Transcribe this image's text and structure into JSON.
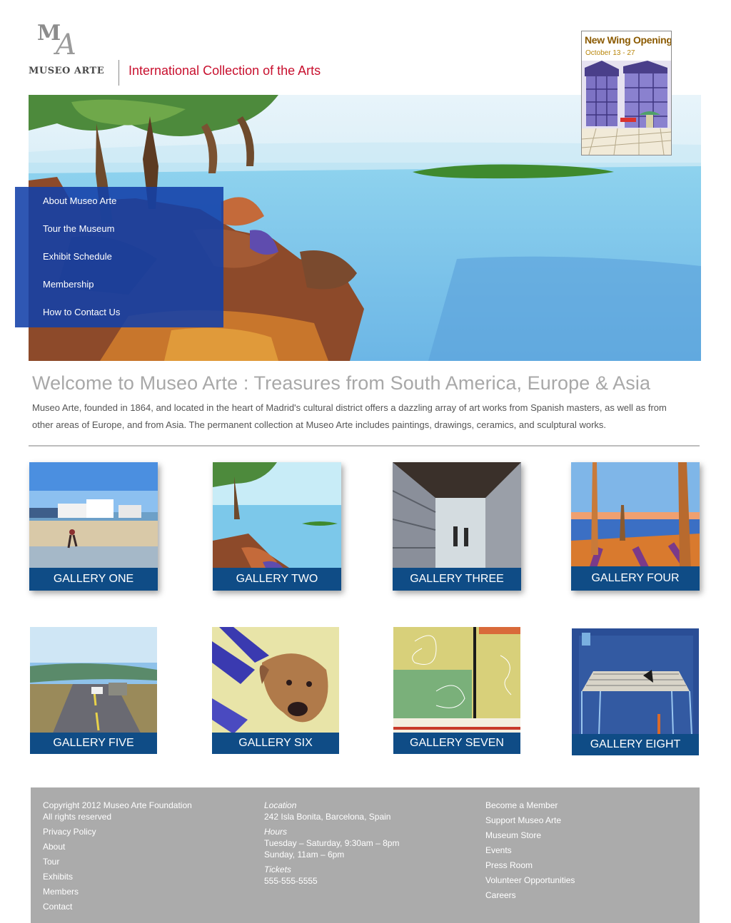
{
  "header": {
    "logo_monogram": "MA",
    "logo_name": "MUSEO ARTE",
    "tagline": "International Collection of the Arts"
  },
  "promo": {
    "title": "New Wing Opening",
    "dates": "October 13 - 27"
  },
  "nav": {
    "items": [
      {
        "label": "About Museo Arte"
      },
      {
        "label": "Tour the Museum"
      },
      {
        "label": "Exhibit Schedule"
      },
      {
        "label": "Membership"
      },
      {
        "label": "How to Contact Us"
      }
    ]
  },
  "welcome": {
    "title": "Welcome to Museo Arte : Treasures from South America, Europe & Asia",
    "body": "Museo Arte, founded in 1864, and located in the heart of Madrid's cultural district offers a dazzling array of art works from Spanish masters, as well as from other areas of Europe, and from Asia. The permanent collection at Museo Arte includes paintings, drawings, ceramics, and sculptural works."
  },
  "galleries": [
    {
      "label": "GALLERY ONE"
    },
    {
      "label": "GALLERY TWO"
    },
    {
      "label": "GALLERY THREE"
    },
    {
      "label": "GALLERY FOUR"
    },
    {
      "label": "GALLERY FIVE"
    },
    {
      "label": "GALLERY SIX"
    },
    {
      "label": "GALLERY SEVEN"
    },
    {
      "label": "GALLERY EIGHT"
    }
  ],
  "footer": {
    "copyright": "Copyright 2012 Museo Arte Foundation",
    "rights": "All rights reserved",
    "left_links": [
      "Privacy Policy",
      "About",
      "Tour",
      "Exhibits",
      "Members",
      "Contact"
    ],
    "location_heading": "Location",
    "address": "242 Isla Bonita, Barcelona, Spain",
    "hours_heading": "Hours",
    "hours_line1": "Tuesday – Saturday, 9:30am – 8pm",
    "hours_line2": "Sunday, 11am – 6pm",
    "tickets_heading": "Tickets",
    "phone": "555-555-5555",
    "right_links": [
      "Become a Member",
      "Support Museo Arte",
      "Museum Store",
      "Events",
      "Press Room",
      "Volunteer Opportunities",
      "Careers"
    ]
  },
  "colors": {
    "accent_red": "#c8102e",
    "nav_blue": "#1240a8",
    "gallery_label_blue": "#0f4c86",
    "footer_gray": "#ababab"
  }
}
